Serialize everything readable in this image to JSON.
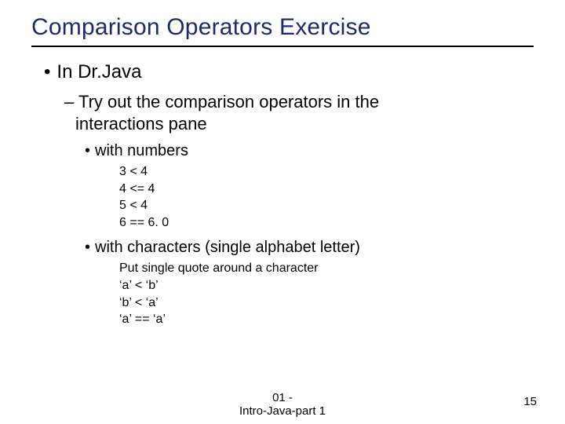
{
  "title": "Comparison Operators Exercise",
  "lvl1": "In Dr.Java",
  "lvl2_a": "– Try out the comparison operators in the",
  "lvl2_b": "interactions pane",
  "section_numbers_label": "with numbers",
  "numbers": {
    "l1": "3 < 4",
    "l2": "4 <= 4",
    "l3": "5 < 4",
    "l4": "6 == 6. 0"
  },
  "section_chars_label": "with characters (single alphabet letter)",
  "chars": {
    "note": "Put single quote around a character",
    "l1": "‘a’ < ‘b’",
    "l2": "‘b’ < ‘a’",
    "l3": "‘a’ == ‘a’"
  },
  "footer": {
    "line1": "01 -",
    "line2": "Intro-Java-part 1",
    "page": "15"
  }
}
